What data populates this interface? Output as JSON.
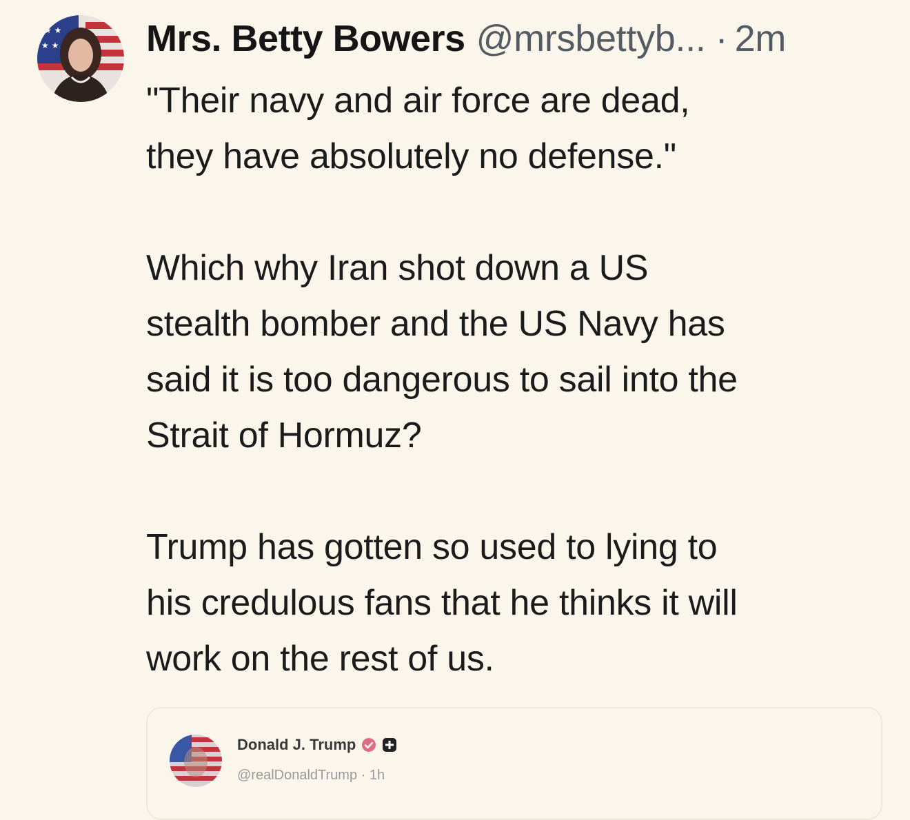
{
  "post": {
    "author": {
      "display_name": "Mrs. Betty Bowers",
      "handle": "@mrsbettyb...",
      "separator": "·",
      "time": "2m",
      "avatar": "profile-photo-woman-flag-background"
    },
    "paragraphs": [
      "\"Their navy and air force are dead,\nthey have absolutely no defense.\"",
      "Which why Iran shot down a US\nstealth bomber and the US Navy has\nsaid it is too dangerous to sail into the\nStrait of Hormuz?",
      "Trump has gotten so used to lying to\nhis credulous fans that he thinks it will\nwork on the rest of us."
    ]
  },
  "quoted_post": {
    "display_name": "Donald J. Trump",
    "handle": "@realDonaldTrump",
    "separator": "·",
    "time": "1h",
    "meta": "@realDonaldTrump · 1h",
    "verified_badge": "verified-check-icon",
    "extra_badge": "plus-badge-icon",
    "avatar": "profile-photo-flag-overlay",
    "colors": {
      "verified": "#e06d86",
      "plus_badge": "#222222"
    }
  },
  "colors": {
    "background": "#fbf6ec",
    "text": "#1b1b1b",
    "muted": "#555b63"
  }
}
